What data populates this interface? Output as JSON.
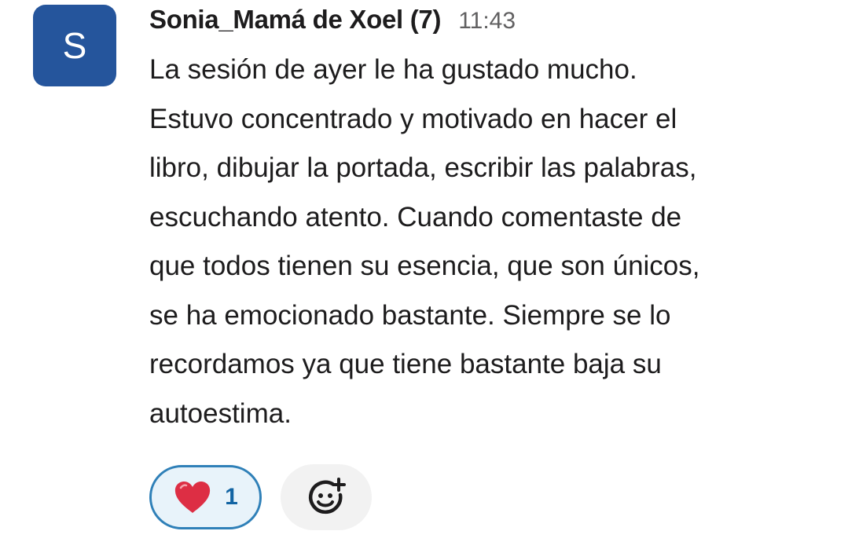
{
  "message": {
    "avatar_initial": "S",
    "avatar_color": "#25559c",
    "sender": "Sonia_Mamá de Xoel (7)",
    "timestamp": "11:43",
    "lines": [
      "La sesión de ayer le ha gustado mucho.",
      "Estuvo concentrado y motivado en hacer el",
      "libro, dibujar la portada, escribir las palabras,",
      "escuchando atento. Cuando comentaste de",
      "que todos tienen su esencia, que son únicos,",
      "se ha emocionado bastante. Siempre se lo",
      "recordamos ya que tiene bastante baja su",
      "autoestima."
    ]
  },
  "reactions": [
    {
      "icon": "red-heart-icon",
      "count": "1",
      "selected": true
    }
  ],
  "add_reaction": {
    "icon": "add-emoji-icon"
  },
  "colors": {
    "selected_border": "#2f80b8",
    "selected_bg": "#e8f3fa",
    "count_text": "#1264a3",
    "heart": "#dd2e44",
    "add_reaction_bg": "#f2f2f2"
  }
}
